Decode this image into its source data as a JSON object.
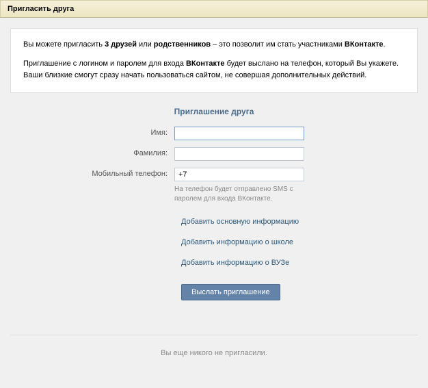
{
  "header": {
    "title": "Пригласить друга"
  },
  "info": {
    "line1_a": "Вы можете пригласить ",
    "line1_b": "3 друзей",
    "line1_c": " или ",
    "line1_d": "родственников",
    "line1_e": " – это позволит им стать участниками ",
    "line1_f": "ВКонтакте",
    "line1_g": ".",
    "line2_a": "Приглашение с логином и паролем для входа ",
    "line2_b": "ВКонтакте",
    "line2_c": " будет выслано на телефон, который Вы укажете. Ваши близкие смогут сразу начать пользоваться сайтом, не совершая дополнительных действий."
  },
  "form": {
    "title": "Приглашение друга",
    "name_label": "Имя:",
    "name_value": "",
    "surname_label": "Фамилия:",
    "surname_value": "",
    "phone_label": "Мобильный телефон:",
    "phone_value": "+7",
    "phone_hint": "На телефон будет отправлено SMS с паролем для входа ВКонтакте."
  },
  "links": {
    "basic": "Добавить основную информацию",
    "school": "Добавить информацию о школе",
    "university": "Добавить информацию о ВУЗе"
  },
  "button": {
    "submit": "Выслать приглашение"
  },
  "empty": {
    "message": "Вы еще никого не пригласили."
  }
}
